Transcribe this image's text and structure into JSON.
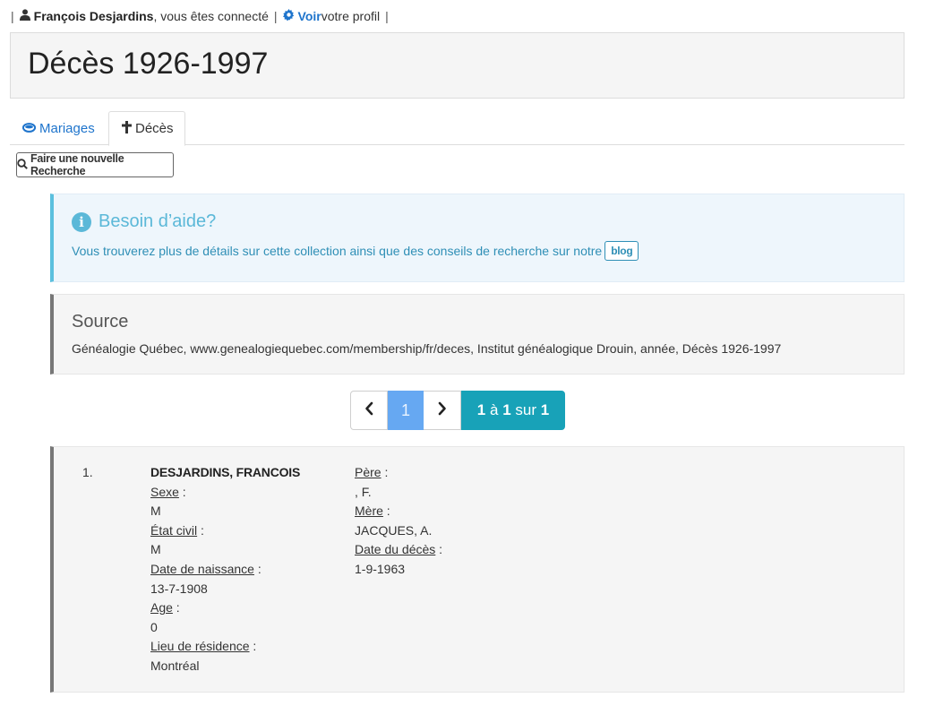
{
  "topbar": {
    "sep": "|",
    "user_name": "François Desjardins",
    "connected_text": ", vous êtes connecté",
    "voir_label": "Voir",
    "profile_text": " votre profil",
    "icons": {
      "user": "user-icon",
      "settings": "gear-icon"
    }
  },
  "page": {
    "title": "Décès 1926-1997"
  },
  "tabs": [
    {
      "label": "Mariages",
      "icon": "rings-icon",
      "active": false
    },
    {
      "label": "Décès",
      "icon": "cross-icon",
      "active": true
    }
  ],
  "new_search": {
    "label": "Faire une nouvelle Recherche",
    "icon": "search-icon"
  },
  "help": {
    "title": "Besoin d’aide?",
    "text": "Vous trouverez plus de détails sur cette collection ainsi que des conseils de recherche sur notre",
    "blog_label": "blog",
    "icon": "info-icon"
  },
  "source": {
    "title": "Source",
    "text": "Généalogie Québec, www.genealogiequebec.com/membership/fr/deces, Institut généalogique Drouin, année, Décès 1926-1997"
  },
  "pagination": {
    "current_page": "1",
    "count_from": "1",
    "count_word": "à",
    "count_to": "1",
    "count_of": "sur",
    "count_total": "1"
  },
  "results": [
    {
      "index": "1.",
      "name": "DESJARDINS, FRANCOIS",
      "sexe_label": "Sexe",
      "sexe": "M",
      "etat_civil_label": "État civil",
      "etat_civil": "M",
      "naissance_label": "Date de naissance",
      "naissance": "13-7-1908",
      "age_label": "Age",
      "age": "0",
      "residence_label": "Lieu de résidence",
      "residence": "Montréal",
      "pere_label": "Père",
      "pere": ", F.",
      "mere_label": "Mère",
      "mere": "JACQUES, A.",
      "deces_label": "Date du décès",
      "deces": "1-9-1963"
    }
  ],
  "colors": {
    "link": "#1e74cc",
    "info": "#5bc0de",
    "page_active": "#66a8f2",
    "count_bg": "#18a2b8"
  }
}
